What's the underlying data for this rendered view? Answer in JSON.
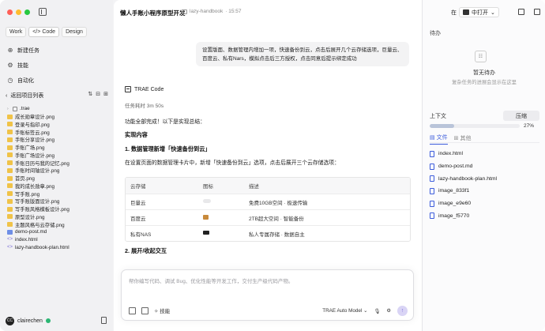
{
  "sidebar": {
    "modes": [
      {
        "label": "Work"
      },
      {
        "label": "Code",
        "icon": "</>"
      },
      {
        "label": "Design"
      }
    ],
    "nav": [
      {
        "label": "新建任务",
        "icon": "⊕"
      },
      {
        "label": "技能",
        "icon": "⚙"
      },
      {
        "label": "自动化",
        "icon": "◷"
      }
    ],
    "back_label": "返回项目列表",
    "tree": [
      {
        "name": ".trae",
        "kind": "dir"
      },
      {
        "name": "成长勋章设计.png",
        "kind": "img"
      },
      {
        "name": "登录与指印.png",
        "kind": "img"
      },
      {
        "name": "手账标签云.png",
        "kind": "img"
      },
      {
        "name": "手账分享设计.png",
        "kind": "img"
      },
      {
        "name": "手账广场.png",
        "kind": "img"
      },
      {
        "name": "手账广场设计.png",
        "kind": "img"
      },
      {
        "name": "手账日历与我的记忆.png",
        "kind": "img"
      },
      {
        "name": "手账时间轴设计.png",
        "kind": "img"
      },
      {
        "name": "首页.png",
        "kind": "img"
      },
      {
        "name": "我的成长勋章.png",
        "kind": "img"
      },
      {
        "name": "写手账.png",
        "kind": "img"
      },
      {
        "name": "写手账版面设计.png",
        "kind": "img"
      },
      {
        "name": "写手账风格模板设计.png",
        "kind": "img"
      },
      {
        "name": "原型设计.png",
        "kind": "img"
      },
      {
        "name": "主题风格与云存储.png",
        "kind": "img"
      },
      {
        "name": "demo-post.md",
        "kind": "md"
      },
      {
        "name": "index.html",
        "kind": "html"
      },
      {
        "name": "lazy-handbook-plan.html",
        "kind": "html"
      }
    ],
    "user": {
      "name": "clairechen",
      "initials": "CC"
    }
  },
  "main": {
    "title": "懒人手账小程序原型开发",
    "crumb_folder": "lazy-handbook",
    "crumb_time": "· 15:57",
    "user_message": "设置版面、数据管理内增加一项，快速备份到云，点击后展开几个云存储选项，巨量云、百度云、私有Nars，模拟点击后三方授权，点击同意后提示绑定成功",
    "agent_name": "TRAE Code",
    "elapsed": "任务耗时 3m 50s",
    "intro": "功能全部完成！以下是实现总结：",
    "h_impl": "实现内容",
    "h_section1": "1. 数据管理新增「快速备份到云」",
    "section1_body": "在设置页面的数据管理卡片中，新增「快速备份到云」选项，点击后展开三个云存储选项：",
    "table": {
      "headers": [
        "云存储",
        "图标",
        "描述"
      ],
      "rows": [
        {
          "name": "巨量云",
          "icon": "cloud",
          "desc": "免费10GB空间 · 极速传输"
        },
        {
          "name": "百度云",
          "icon": "box",
          "desc": "2TB超大空间 · 智能备份"
        },
        {
          "name": "私有NAS",
          "icon": "pc",
          "desc": "私人专属存储 · 数据自主"
        }
      ]
    },
    "h_section2": "2. 展开/收起交互",
    "composer_placeholder": "帮你编写代码、调试 Bug、优化性能等开发工作，交付生产级代码产物。",
    "composer_skill": "技能",
    "model": "TRAE Auto Model"
  },
  "right": {
    "open_prefix": "在",
    "open_label": "中打开",
    "todo_label": "待办",
    "todo_empty": "暂无待办",
    "todo_hint": "复杂任务的进展会显示在这里",
    "ctx_label": "上下文",
    "compress_label": "压缩",
    "ctx_pct_value": 0.27,
    "ctx_pct_text": "27%",
    "tab_files": "文件",
    "tab_other": "其他",
    "files": [
      "index.html",
      "demo-post.md",
      "lazy-handbook-plan.html",
      "image_833f1",
      "image_e9e60",
      "image_f5770"
    ]
  },
  "colors": {
    "accent": "#3b5bdb",
    "send": "#d9d4f5",
    "folder": "#f0c348"
  }
}
